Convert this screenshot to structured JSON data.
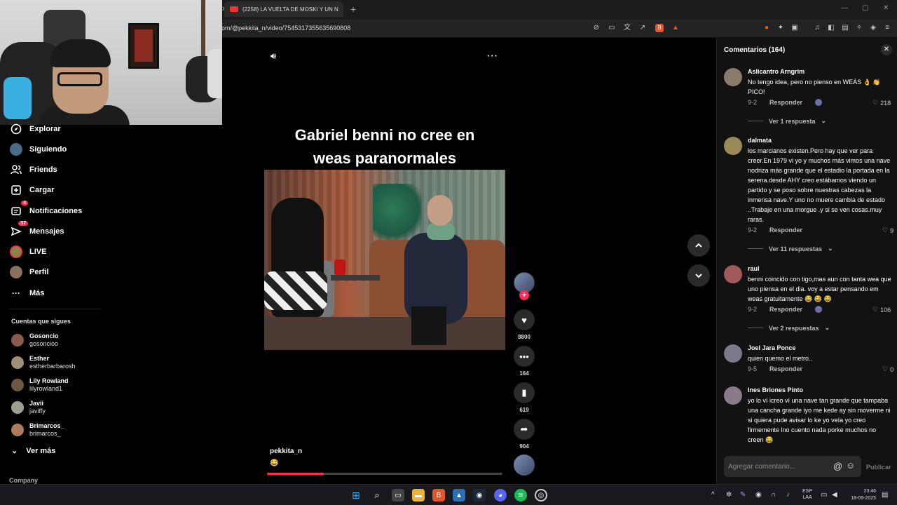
{
  "browser": {
    "tab_title": "(2258) LA VUELTA DE MOSKI Y UN N",
    "url": "om/@pekkita_n/video/7545317355635690808"
  },
  "nav": {
    "items": [
      {
        "label": "Explorar",
        "icon": "compass-icon"
      },
      {
        "label": "Siguiendo",
        "icon": "following-avatar-icon"
      },
      {
        "label": "Friends",
        "icon": "friends-icon"
      },
      {
        "label": "Cargar",
        "icon": "upload-icon"
      },
      {
        "label": "Notificaciones",
        "icon": "notifications-icon",
        "badge": "4"
      },
      {
        "label": "Mensajes",
        "icon": "messages-icon",
        "badge": "37"
      },
      {
        "label": "LIVE",
        "icon": "live-icon"
      },
      {
        "label": "Perfil",
        "icon": "profile-icon"
      },
      {
        "label": "Más",
        "icon": "more-icon"
      }
    ],
    "following_header": "Cuentas que sigues",
    "following": [
      {
        "name": "Gosoncio",
        "user": "gosoncioo"
      },
      {
        "name": "Esther",
        "user": "estherbarbarosh"
      },
      {
        "name": "Lily Rowland",
        "user": "lilyrowland1"
      },
      {
        "name": "Javii",
        "user": "javiffy"
      },
      {
        "name": "Brimarcos_",
        "user": "brimarcos_"
      }
    ],
    "see_more": "Ver más",
    "company": "Company"
  },
  "video": {
    "title_line1": "Gabriel benni no cree en",
    "title_line2": "weas paranormales",
    "likes": "8800",
    "comments": "164",
    "saves": "619",
    "shares": "904",
    "author": "pekkita_n",
    "caption_emoji": "😂",
    "progress": 0.24
  },
  "comments_panel": {
    "header": "Comentarios (164)",
    "reply_label": "Responder",
    "items": [
      {
        "name": "Aslicantro Arngrim",
        "text": "No tengo idea, pero no pienso en WEÁS 👌 👏 PICO!",
        "date": "9-2",
        "likes": "218",
        "creator_liked": true,
        "replies": "Ver 1 respuesta"
      },
      {
        "name": "dalmata",
        "text": "los marcianos existen.Pero hay que ver para creer.En 1979 vi yo y muchos más vimos una nave nodriza más grande que el estadio la portada en la serena.desde AHY creo estábamos viendo un partido y se poso sobre nuestras cabezas la inmensa nave.Y uno no muere cambia de estado ..Trabaje en una morgue .y si se ven cosas.muy raras.",
        "date": "9-2",
        "likes": "9",
        "creator_liked": false,
        "replies": "Ver 11 respuestas"
      },
      {
        "name": "raul",
        "text": "benni coincido con tigo,mas aun con tanta wea que uno piensa en el dia. voy a estar pensando em weas gratuitamente 😂 😂 😂",
        "date": "9-2",
        "likes": "106",
        "creator_liked": true,
        "replies": "Ver 2 respuestas"
      },
      {
        "name": "Joel Jara Ponce",
        "text": "quien quemo el metro..",
        "date": "9-5",
        "likes": "0",
        "creator_liked": false,
        "replies": ""
      },
      {
        "name": "Ines Briones Pinto",
        "text": "yo lo ví icreo ví una nave tan grande que tampaba una cancha grande iyo me kede ay sin moverme ni si quiera pude avisar lo ke yo veía yo creo firmemente lno cuento nada porke muchos no creen 😂",
        "date": "",
        "likes": "",
        "creator_liked": false,
        "replies": ""
      }
    ],
    "input_placeholder": "Agregar comentario...",
    "post_label": "Publicar"
  },
  "taskbar": {
    "lang_line1": "ESP",
    "lang_line2": "LAA",
    "time": "23:46",
    "date": "18-09-2025"
  },
  "colors": {
    "accent": "#fe2c55",
    "panel": "#121212"
  }
}
